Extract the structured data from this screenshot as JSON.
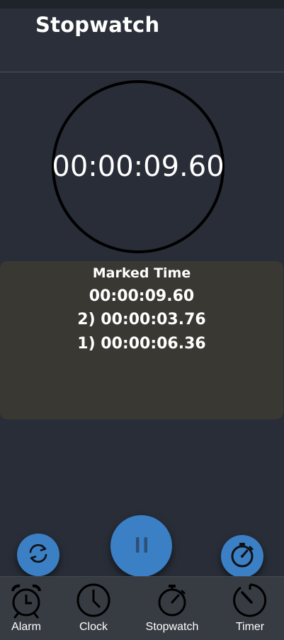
{
  "header": {
    "title": "Stopwatch"
  },
  "stopwatch": {
    "display": "00:00:09.60"
  },
  "marked": {
    "title": "Marked Time",
    "current": "00:00:09.60",
    "laps": [
      "2) 00:00:03.76",
      "1) 00:00:06.36"
    ]
  },
  "controls": {
    "reset_icon": "refresh-icon",
    "pause_icon": "pause-icon",
    "lap_icon": "stopwatch-icon"
  },
  "nav": {
    "items": [
      {
        "label": "Alarm",
        "icon": "alarm-clock-icon"
      },
      {
        "label": "Clock",
        "icon": "clock-icon"
      },
      {
        "label": "Stopwatch",
        "icon": "stopwatch-icon"
      },
      {
        "label": "Timer",
        "icon": "timer-icon"
      }
    ]
  },
  "colors": {
    "background": "#282d37",
    "accent": "#3b7fc5",
    "panel": "#393833",
    "nav_bar": "#373b42"
  }
}
